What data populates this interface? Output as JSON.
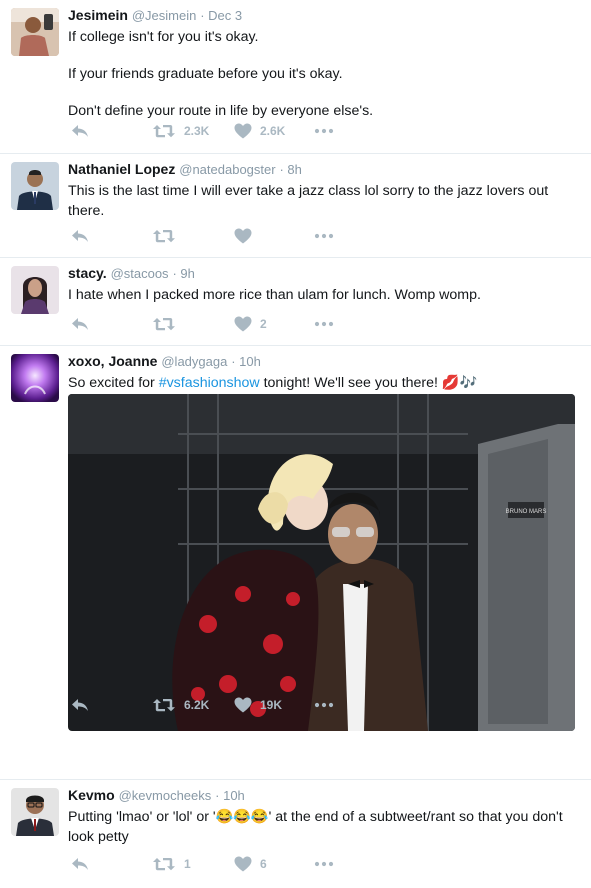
{
  "tweets": [
    {
      "name": "Jesimein",
      "handle": "@Jesimein",
      "time": "· Dec 3",
      "lines": [
        "If college isn't for you it's okay.",
        "If your friends graduate before you it's okay.",
        "Don't define your route in life by everyone else's."
      ],
      "retweets": "2.3K",
      "likes": "2.6K"
    },
    {
      "name": "Nathaniel Lopez",
      "handle": "@natedabogster",
      "time": "· 8h",
      "lines": [
        "This is the last time I will ever take a jazz class lol sorry to the jazz lovers out there."
      ],
      "retweets": "",
      "likes": ""
    },
    {
      "name": "stacy.",
      "handle": "@stacoos",
      "time": "· 9h",
      "lines": [
        "I hate when I packed more rice than ulam for lunch. Womp womp."
      ],
      "retweets": "",
      "likes": "2"
    },
    {
      "name": "xoxo, Joanne",
      "handle": "@ladygaga",
      "time": "· 10h",
      "text_before": "So excited for ",
      "hashtag": "#vsfashionshow",
      "text_after": " tonight! We'll see you there! 💋🎶",
      "media_label": "BRUNO MARS",
      "retweets": "6.2K",
      "likes": "19K"
    },
    {
      "name": "Kevmo",
      "handle": "@kevmocheeks",
      "time": "· 10h",
      "lines": [
        "Putting 'lmao' or 'lol' or '😂😂😂' at the end of a subtweet/rant so that you don't look petty"
      ],
      "retweets": "1",
      "likes": "6"
    }
  ],
  "icons": {
    "reply": "reply-icon",
    "retweet": "retweet-icon",
    "like": "heart-icon",
    "more": "more-icon"
  },
  "colors": {
    "icon_gray": "#aab8c2",
    "secondary_text": "#8899a6",
    "link_blue": "#1b95e0",
    "divider": "#e6ecf0"
  }
}
